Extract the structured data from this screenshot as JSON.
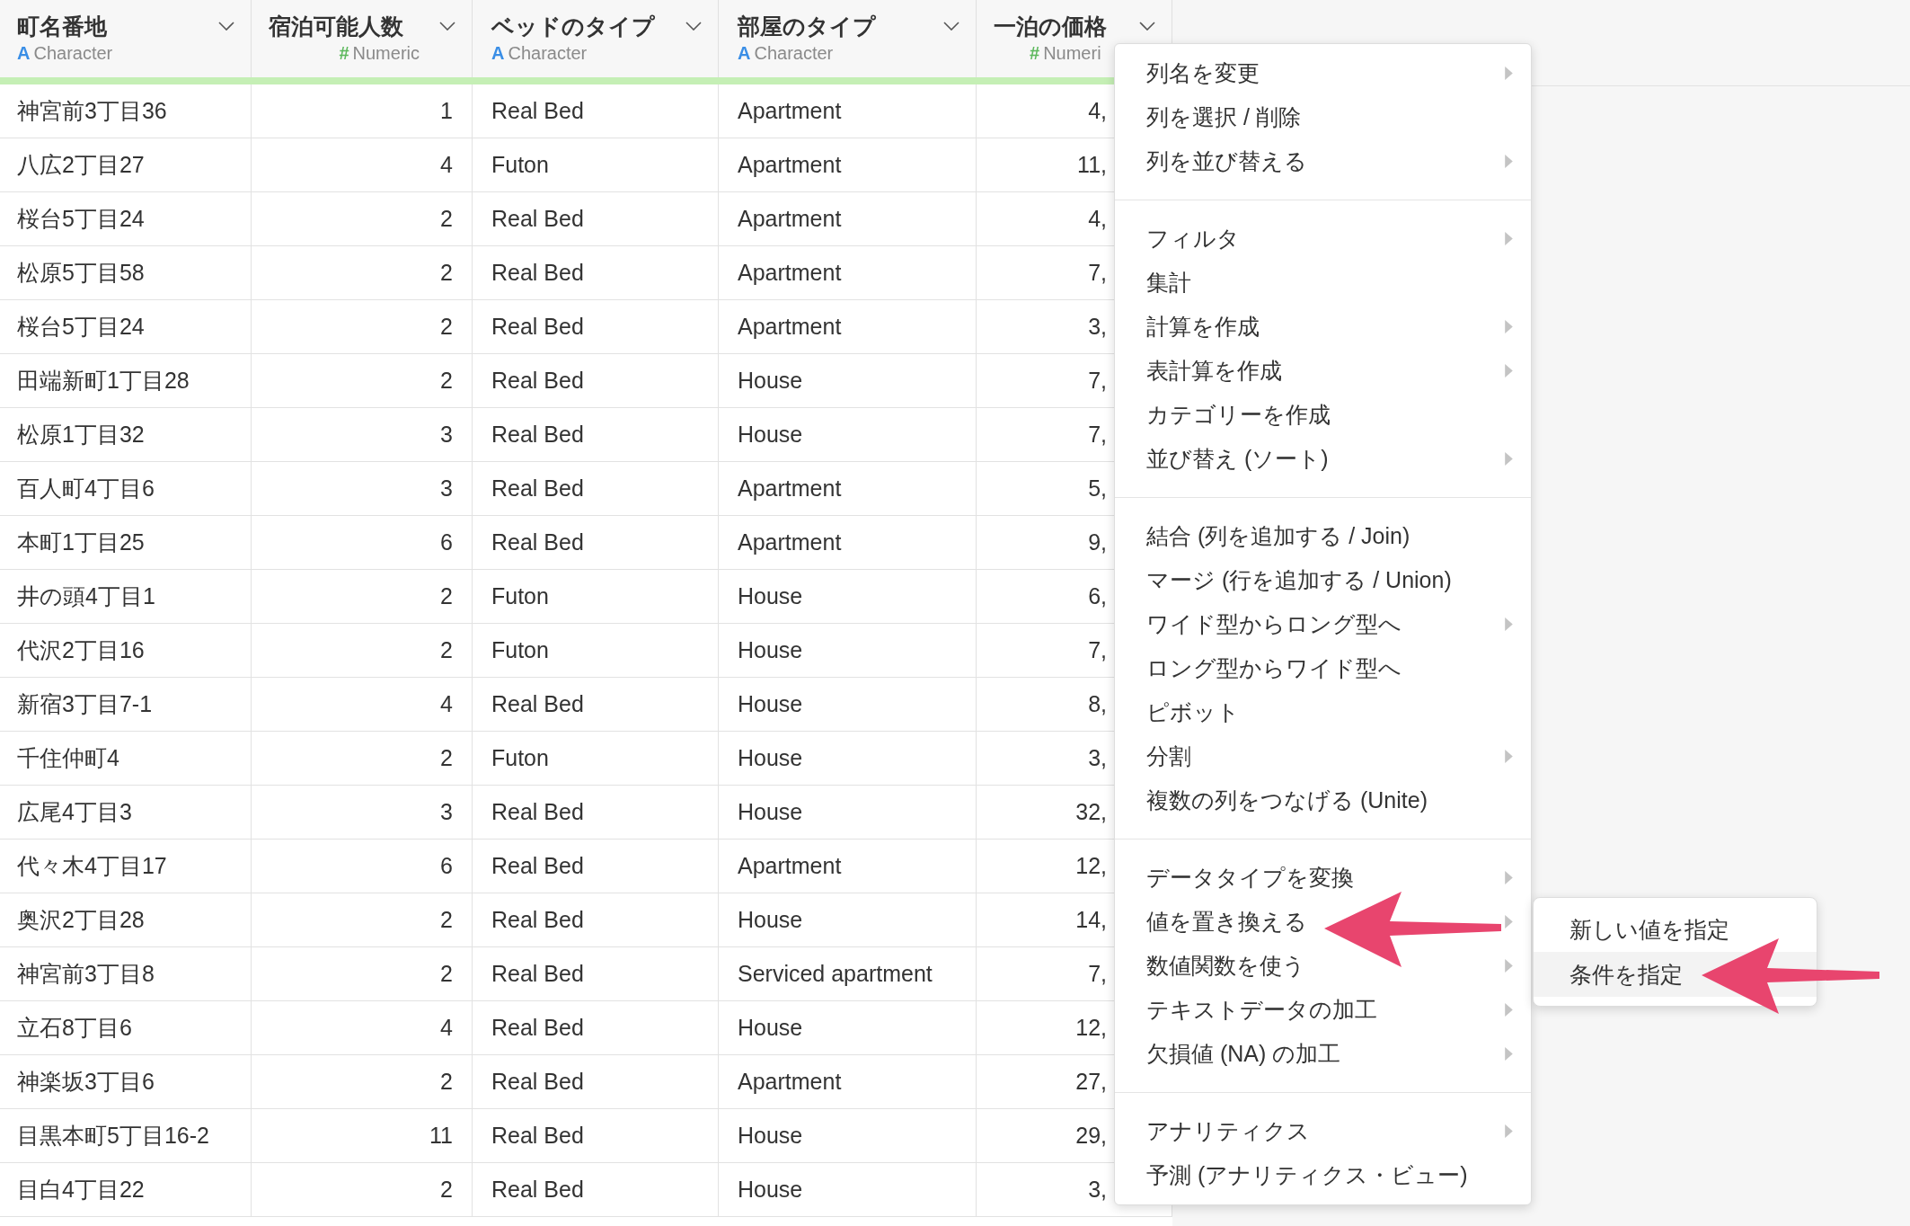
{
  "table": {
    "columns": [
      {
        "title": "町名番地",
        "type": {
          "kind": "character",
          "icon": "A",
          "label": "Character"
        }
      },
      {
        "title": "宿泊可能人数",
        "type": {
          "kind": "numeric",
          "icon": "#",
          "label": "Numeric"
        }
      },
      {
        "title": "ベッドのタイプ",
        "type": {
          "kind": "character",
          "icon": "A",
          "label": "Character"
        }
      },
      {
        "title": "部屋のタイプ",
        "type": {
          "kind": "character",
          "icon": "A",
          "label": "Character"
        }
      },
      {
        "title": "一泊の価格",
        "type": {
          "kind": "numeric",
          "icon": "#",
          "label": "Numeri"
        }
      }
    ],
    "rows": [
      [
        "神宮前3丁目36",
        "1",
        "Real Bed",
        "Apartment",
        "4,"
      ],
      [
        "八広2丁目27",
        "4",
        "Futon",
        "Apartment",
        "11,"
      ],
      [
        "桜台5丁目24",
        "2",
        "Real Bed",
        "Apartment",
        "4,"
      ],
      [
        "松原5丁目58",
        "2",
        "Real Bed",
        "Apartment",
        "7,"
      ],
      [
        "桜台5丁目24",
        "2",
        "Real Bed",
        "Apartment",
        "3,"
      ],
      [
        "田端新町1丁目28",
        "2",
        "Real Bed",
        "House",
        "7,"
      ],
      [
        "松原1丁目32",
        "3",
        "Real Bed",
        "House",
        "7,"
      ],
      [
        "百人町4丁目6",
        "3",
        "Real Bed",
        "Apartment",
        "5,"
      ],
      [
        "本町1丁目25",
        "6",
        "Real Bed",
        "Apartment",
        "9,"
      ],
      [
        "井の頭4丁目1",
        "2",
        "Futon",
        "House",
        "6,"
      ],
      [
        "代沢2丁目16",
        "2",
        "Futon",
        "House",
        "7,"
      ],
      [
        "新宿3丁目7-1",
        "4",
        "Real Bed",
        "House",
        "8,"
      ],
      [
        "千住仲町4",
        "2",
        "Futon",
        "House",
        "3,"
      ],
      [
        "広尾4丁目3",
        "3",
        "Real Bed",
        "House",
        "32,"
      ],
      [
        "代々木4丁目17",
        "6",
        "Real Bed",
        "Apartment",
        "12,"
      ],
      [
        "奥沢2丁目28",
        "2",
        "Real Bed",
        "House",
        "14,"
      ],
      [
        "神宮前3丁目8",
        "2",
        "Real Bed",
        "Serviced apartment",
        "7,"
      ],
      [
        "立石8丁目6",
        "4",
        "Real Bed",
        "House",
        "12,"
      ],
      [
        "神楽坂3丁目6",
        "2",
        "Real Bed",
        "Apartment",
        "27,"
      ],
      [
        "目黒本町5丁目16-2",
        "11",
        "Real Bed",
        "House",
        "29,"
      ],
      [
        "目白4丁目22",
        "2",
        "Real Bed",
        "House",
        "3,"
      ]
    ]
  },
  "context_menu": {
    "groups": [
      [
        {
          "label": "列名を変更",
          "has_submenu": true
        },
        {
          "label": "列を選択 / 削除",
          "has_submenu": false
        },
        {
          "label": "列を並び替える",
          "has_submenu": true
        }
      ],
      [
        {
          "label": "フィルタ",
          "has_submenu": true
        },
        {
          "label": "集計",
          "has_submenu": false
        },
        {
          "label": "計算を作成",
          "has_submenu": true
        },
        {
          "label": "表計算を作成",
          "has_submenu": true
        },
        {
          "label": "カテゴリーを作成",
          "has_submenu": false
        },
        {
          "label": "並び替え (ソート)",
          "has_submenu": true
        }
      ],
      [
        {
          "label": "結合 (列を追加する / Join)",
          "has_submenu": false
        },
        {
          "label": "マージ (行を追加する / Union)",
          "has_submenu": false
        },
        {
          "label": "ワイド型からロング型へ",
          "has_submenu": true
        },
        {
          "label": "ロング型からワイド型へ",
          "has_submenu": false
        },
        {
          "label": "ピボット",
          "has_submenu": false
        },
        {
          "label": "分割",
          "has_submenu": true
        },
        {
          "label": "複数の列をつなげる (Unite)",
          "has_submenu": false
        }
      ],
      [
        {
          "label": "データタイプを変換",
          "has_submenu": true
        },
        {
          "label": "値を置き換える",
          "has_submenu": true
        },
        {
          "label": "数値関数を使う",
          "has_submenu": true
        },
        {
          "label": "テキストデータの加工",
          "has_submenu": true
        },
        {
          "label": "欠損値 (NA) の加工",
          "has_submenu": true
        }
      ],
      [
        {
          "label": "アナリティクス",
          "has_submenu": true
        },
        {
          "label": "予測 (アナリティクス・ビュー)",
          "has_submenu": false
        }
      ]
    ]
  },
  "submenu": {
    "items": [
      {
        "label": "新しい値を指定",
        "selected": false
      },
      {
        "label": "条件を指定",
        "selected": true
      }
    ]
  }
}
